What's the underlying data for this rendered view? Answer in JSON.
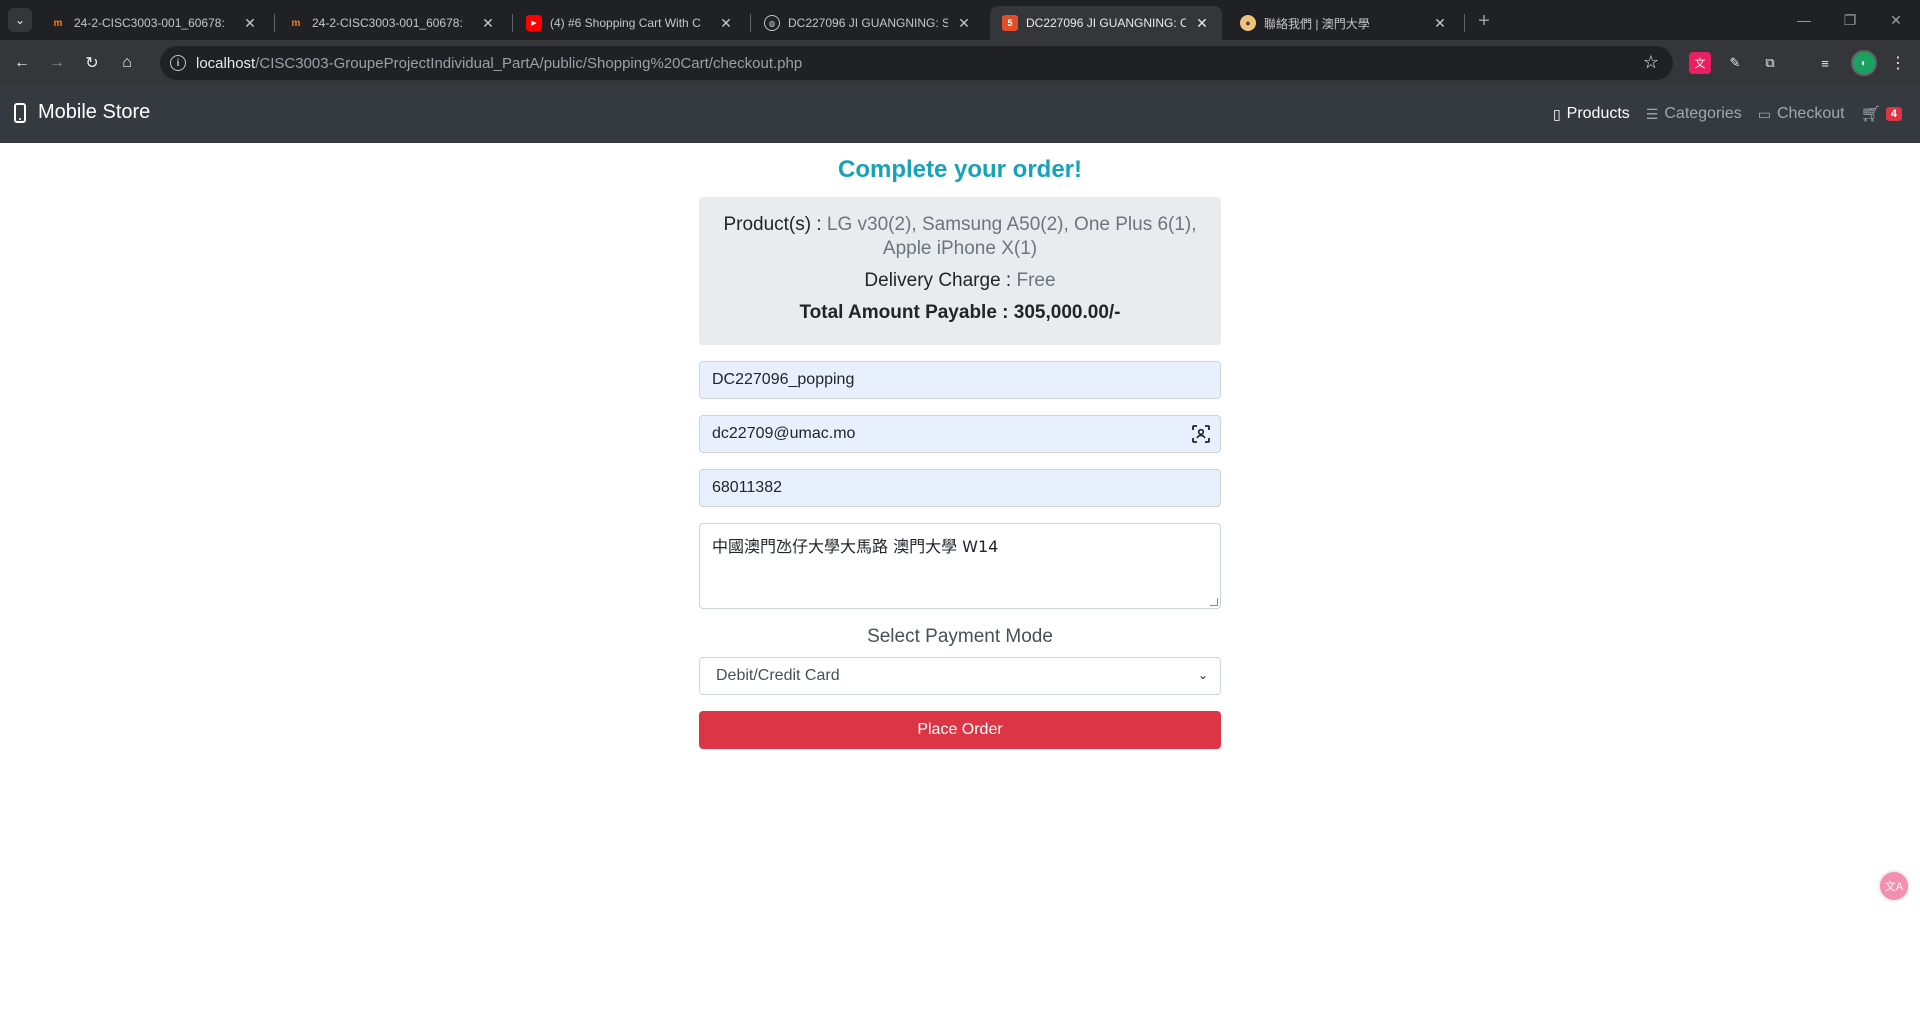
{
  "browser": {
    "tabs": [
      {
        "title": "24-2-CISC3003-001_60678:",
        "favicon": "moodle-icon",
        "active": false
      },
      {
        "title": "24-2-CISC3003-001_60678:",
        "favicon": "moodle-icon",
        "active": false
      },
      {
        "title": "(4) #6 Shopping Cart With C",
        "favicon": "youtube-icon",
        "active": false
      },
      {
        "title": "DC227096 JI GUANGNING: S",
        "favicon": "globe-icon",
        "active": false
      },
      {
        "title": "DC227096 JI GUANGNING: C",
        "favicon": "html5-icon",
        "active": true
      },
      {
        "title": "聯絡我們 | 澳門大學",
        "favicon": "person-icon",
        "active": false
      }
    ],
    "url_host": "localhost",
    "url_path": "/CISC3003-GroupeProjectIndividual_PartA/public/Shopping%20Cart/checkout.php"
  },
  "navbar": {
    "brand": "Mobile Store",
    "links": {
      "products": "Products",
      "categories": "Categories",
      "checkout": "Checkout"
    },
    "cart_count": "4"
  },
  "order": {
    "heading": "Complete your order!",
    "products_label": "Product(s) :",
    "products_value": "LG v30(2), Samsung A50(2), One Plus 6(1), Apple iPhone X(1)",
    "delivery_label": "Delivery Charge :",
    "delivery_value": "Free",
    "total_label": "Total Amount Payable :",
    "total_value": "305,000.00/-"
  },
  "form": {
    "name": "DC227096_popping",
    "email": "dc22709@umac.mo",
    "phone": "68011382",
    "address": "中國澳門氹仔大學大馬路  澳門大學 W14",
    "payment_label": "Select Payment Mode",
    "payment_selected": "Debit/Credit Card",
    "submit_label": "Place Order"
  },
  "colors": {
    "accent": "#17a2b8",
    "danger": "#dc3545",
    "navbar": "#343a40"
  }
}
